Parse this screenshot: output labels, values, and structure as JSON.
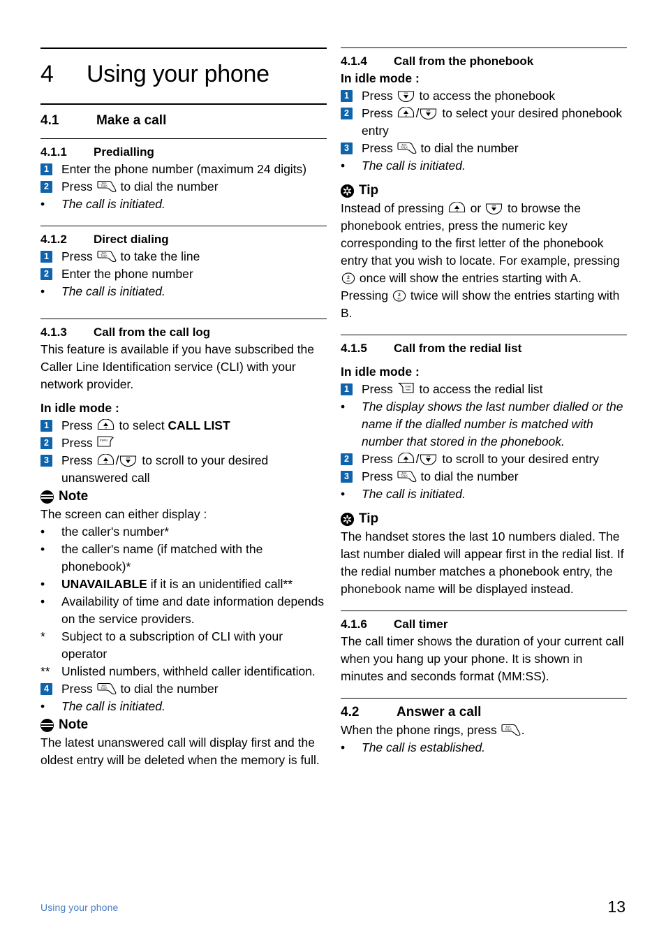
{
  "page": {
    "number": "13",
    "footer_section": "Using your phone"
  },
  "chapter": {
    "number": "4",
    "title": "Using your phone"
  },
  "left_column": {
    "section_41": {
      "number": "4.1",
      "title": "Make a call"
    },
    "section_411": {
      "number": "4.1.1",
      "title": "Predialling",
      "step1": "Enter the phone number (maximum 24 digits)",
      "step2_pre": "Press",
      "step2_post": "to dial the number",
      "bullet1": "The call is initiated."
    },
    "section_412": {
      "number": "4.1.2",
      "title": "Direct dialing",
      "step1_pre": "Press",
      "step1_post": "to take the line",
      "step2": "Enter the phone number",
      "bullet1": "The call is initiated."
    },
    "section_413": {
      "number": "4.1.3",
      "title": "Call from the call log",
      "intro": "This feature is available if you have subscribed the Caller Line Identification service (CLI) with your network provider.",
      "idle_heading": "In idle mode :",
      "step1_pre": "Press",
      "step1_mid": "to select",
      "step1_strong": "CALL LIST",
      "step2_pre": "Press",
      "step3_pre": "Press",
      "step3_post": "to scroll to your desired unanswered call",
      "note_label": "Note",
      "note_intro": "The screen can either display :",
      "note_b1": "the caller's number*",
      "note_b2": "the caller's name (if matched with the phonebook)*",
      "note_b3_strong": "UNAVAILABLE",
      "note_b3_rest": "if it is an unidentified call**",
      "note_b4": "Availability of time and date information depends on the service providers.",
      "fn1_mark": "*",
      "fn1_text": "Subject to a subscription of CLI with your operator",
      "fn2_mark": "**",
      "fn2_text": "Unlisted numbers, withheld caller identification.",
      "step4_pre": "Press",
      "step4_post": "to dial the number",
      "bullet_italic": "The call is initiated.",
      "note2_label": "Note",
      "note2_text": "The latest unanswered call will display first and the oldest entry will be deleted when the memory is full."
    }
  },
  "right_column": {
    "section_414": {
      "number": "4.1.4",
      "title": "Call from the phonebook",
      "idle_heading": "In idle mode :",
      "step1_pre": "Press",
      "step1_post": "to access the phonebook",
      "step2_pre": "Press",
      "step2_post": "to select your desired phonebook entry",
      "step3_pre": "Press",
      "step3_post": "to dial the number",
      "bullet1": "The call is initiated.",
      "tip_label": "Tip",
      "tip_p1": "Instead of pressing",
      "tip_or": "or",
      "tip_p2": "to browse the phonebook entries, press the numeric key corresponding to the first letter of the phonebook entry that you wish to locate. For example, pressing",
      "tip_p3": "once will show the entries starting with A. Pressing",
      "tip_p4": "twice will show the entries starting with B."
    },
    "section_415": {
      "number": "4.1.5",
      "title": "Call from the redial list",
      "idle_heading": "In idle mode :",
      "step1_pre": "Press",
      "step1_post": "to access the redial list",
      "bullet1": "The display shows the last number dialled or the name if the dialled number is matched with number that stored in the phonebook.",
      "step2_pre": "Press",
      "step2_post": "to scroll to your desired entry",
      "step3_pre": "Press",
      "step3_post": "to dial the number",
      "bullet2": "The call is initiated.",
      "tip_label": "Tip",
      "tip_text": "The handset stores the last 10 numbers dialed. The last number dialed will appear first in the redial list. If the redial number matches a phonebook entry, the phonebook name will be displayed instead."
    },
    "section_416": {
      "number": "4.1.6",
      "title": "Call timer",
      "text": "The call timer shows the duration of your current call when you hang up your phone. It is shown in minutes and seconds format (MM:SS)."
    },
    "section_42": {
      "number": "4.2",
      "title": "Answer a call",
      "line_pre": "When the phone rings, press",
      "line_post": ".",
      "bullet1": "The call is established."
    }
  },
  "step_numbers": {
    "one": "1",
    "two": "2",
    "three": "3",
    "four": "4"
  },
  "bullet_char": "•",
  "keys": {
    "talk": {
      "top": "flash",
      "bottom": "TALK"
    },
    "menu": {
      "label": "menu"
    },
    "redial": {
      "top": "redial/",
      "bottom": "mute"
    },
    "up_cll": {
      "label": "cll"
    },
    "down_pbk": {
      "label": "pbk"
    },
    "slash": "/",
    "numkey2": {
      "digit": "2",
      "letters": "abc"
    }
  },
  "colors": {
    "badge_blue": "#0e63ab",
    "footer_blue": "#4a7ec4",
    "text": "#000000",
    "background": "#ffffff"
  }
}
